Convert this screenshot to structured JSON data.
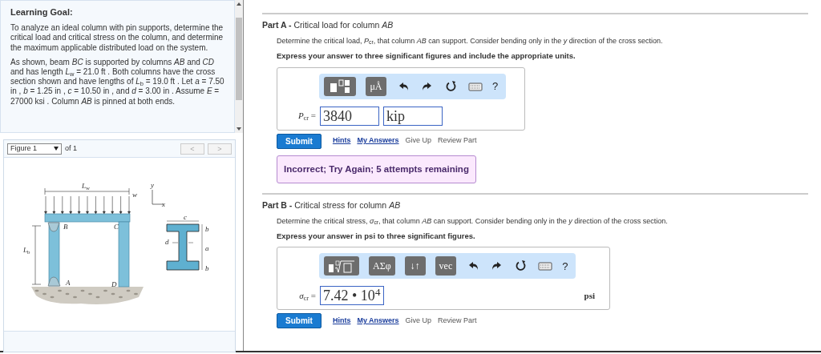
{
  "learning_goal": {
    "title": "Learning Goal:",
    "paragraphs": [
      "To analyze an ideal column with pin supports, determine the critical load and critical stress on the column, and determine the maximum applicable distributed load on the system.",
      "As shown, beam *BC* is supported by columns *AB* and *CD* and has length *L*$_{w}$ = 21.0 ft . Both columns have the cross section shown and have lengths of *L*$_{b}$ = 19.0 ft . Let *a* = 7.50 in , *b* = 1.25 in , *c* = 10.50 in , and *d* = 3.00 in . Assume *E* = 27000 ksi . Column *AB* is pinned at both ends."
    ]
  },
  "figure": {
    "selector": "Figure 1",
    "count": "of 1",
    "prev": {
      "label": "<",
      "disabled": true
    },
    "next": {
      "label": ">",
      "disabled": true
    },
    "labels": [
      "*L*$_{w}$",
      "*w*",
      "*y*",
      "*x*",
      "*B*",
      "*C*",
      "*c*",
      "*b*",
      "*d*",
      "*a*",
      "*b*",
      "*L*$_{b}$",
      "*A*",
      "*D*"
    ]
  },
  "parts": [
    {
      "label": "Part A -",
      "title": "Critical load for column *AB*",
      "prompt": "Determine the critical load, *P*$_{cr}$, that column *AB* can support. Consider bending only in the *y* direction of the cross section.",
      "instruction": "Express your answer to three significant figures and include the appropriate units.",
      "toolbar": [
        {
          "kind": "templates"
        },
        {
          "kind": "text",
          "label": "μÅ"
        },
        {
          "kind": "undo"
        },
        {
          "kind": "redo"
        },
        {
          "kind": "reset"
        },
        {
          "kind": "keyboard"
        },
        {
          "kind": "help",
          "label": "?"
        }
      ],
      "variable": "*P*$_{cr}$ =",
      "answer": {
        "value": "3840",
        "units": "kip"
      },
      "submit": "Submit",
      "links": [
        {
          "label": "Hints",
          "kind": "link"
        },
        {
          "label": "My Answers",
          "kind": "link"
        },
        {
          "label": "Give Up",
          "kind": "plain"
        },
        {
          "label": "Review Part",
          "kind": "plain"
        }
      ],
      "feedback": "Incorrect; Try Again; 5 attempts remaining"
    },
    {
      "label": "Part B -",
      "title": "Critical stress for column *AB*",
      "prompt": "Determine the critical stress, *σ*$_{cr}$, that column *AB* can support. Consider bending only in the *y* direction of the cross section.",
      "instruction": "Express your answer in psi to three significant figures.",
      "toolbar": [
        {
          "kind": "root"
        },
        {
          "kind": "text",
          "label": "ΑΣφ"
        },
        {
          "kind": "text",
          "label": "↓↑"
        },
        {
          "kind": "text",
          "label": "vec"
        },
        {
          "kind": "undo"
        },
        {
          "kind": "redo"
        },
        {
          "kind": "reset"
        },
        {
          "kind": "keyboard"
        },
        {
          "kind": "help",
          "label": "?"
        }
      ],
      "variable": "*σ*$_{cr}$ =",
      "answer": {
        "value": "7.42 • 10$^{4}$",
        "unit_label": "psi"
      },
      "submit": "Submit",
      "links": [
        {
          "label": "Hints",
          "kind": "link"
        },
        {
          "label": "My Answers",
          "kind": "link"
        },
        {
          "label": "Give Up",
          "kind": "plain"
        },
        {
          "label": "Review Part",
          "kind": "plain"
        }
      ]
    }
  ]
}
